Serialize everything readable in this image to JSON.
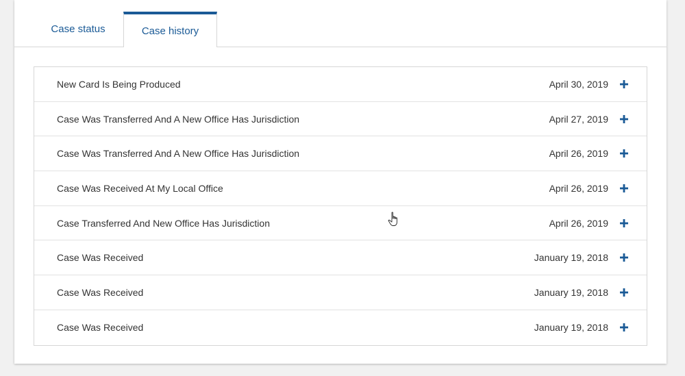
{
  "tabs": [
    {
      "label": "Case status"
    },
    {
      "label": "Case history"
    }
  ],
  "history": [
    {
      "title": "New Card Is Being Produced",
      "date": "April 30, 2019"
    },
    {
      "title": "Case Was Transferred And A New Office Has Jurisdiction",
      "date": "April 27, 2019"
    },
    {
      "title": "Case Was Transferred And A New Office Has Jurisdiction",
      "date": "April 26, 2019"
    },
    {
      "title": "Case Was Received At My Local Office",
      "date": "April 26, 2019"
    },
    {
      "title": "Case Transferred And New Office Has Jurisdiction",
      "date": "April 26, 2019"
    },
    {
      "title": "Case Was Received",
      "date": "January 19, 2018"
    },
    {
      "title": "Case Was Received",
      "date": "January 19, 2018"
    },
    {
      "title": "Case Was Received",
      "date": "January 19, 2018"
    }
  ],
  "icons": {
    "expand": "plus-icon",
    "cursor": "hand-cursor-icon"
  },
  "colors": {
    "accent": "#1a5a96",
    "text": "#333333",
    "border": "#d6d6d6"
  }
}
